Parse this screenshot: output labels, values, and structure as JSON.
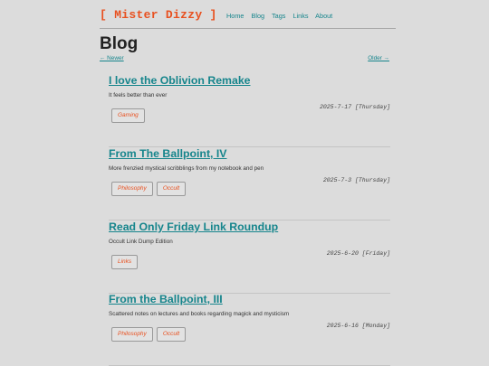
{
  "header": {
    "logo": "[ Mister Dizzy ]",
    "nav": [
      "Home",
      "Blog",
      "Tags",
      "Links",
      "About"
    ]
  },
  "main": {
    "title": "Blog",
    "newer": "← Newer",
    "older": "Older →"
  },
  "posts": [
    {
      "title": "I love the Oblivion Remake",
      "description": "It feels better than ever",
      "date": "2025-7-17 [Thursday]",
      "tags": [
        "Gaming"
      ]
    },
    {
      "title": "From The Ballpoint, IV",
      "description": "More frenzied mystical scribblings from my notebook and pen",
      "date": "2025-7-3 [Thursday]",
      "tags": [
        "Philosophy",
        "Occult"
      ]
    },
    {
      "title": "Read Only Friday Link Roundup",
      "description": "Occult Link Dump Edition",
      "date": "2025-6-20 [Friday]",
      "tags": [
        "Links"
      ]
    },
    {
      "title": "From the Ballpoint, III",
      "description": "Scattered notes on lectures and books regarding magick and mysticism",
      "date": "2025-6-16 [Monday]",
      "tags": [
        "Philosophy",
        "Occult"
      ]
    }
  ]
}
